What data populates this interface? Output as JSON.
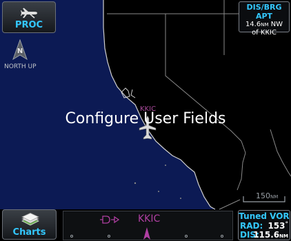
{
  "proc_button": {
    "label": "PROC",
    "icon": "plane-icon"
  },
  "charts_button": {
    "label": "Charts",
    "icon": "charts-stack-icon"
  },
  "dis_brg": {
    "title": "DIS/BRG APT",
    "distance": "14.6",
    "unit": "NM",
    "direction": "NW",
    "line2": "of KKIC"
  },
  "north_up": {
    "label": "NORTH UP",
    "letter": "N"
  },
  "overlay": {
    "text": "Configure User Fields"
  },
  "map": {
    "airport_label": "KKIC",
    "scale": "150",
    "scale_unit": "NM"
  },
  "bottom_bar": {
    "destination": "KKIC"
  },
  "tuned_vor": {
    "title": "Tuned VOR",
    "rad_label": "RAD:",
    "rad_value": "153",
    "dis_label": "DIS:",
    "dis_value": "115.6",
    "dis_unit": "NM"
  },
  "colors": {
    "accent": "#33c8ff",
    "magenta": "#b03fa2",
    "water": "#0c1a54"
  }
}
